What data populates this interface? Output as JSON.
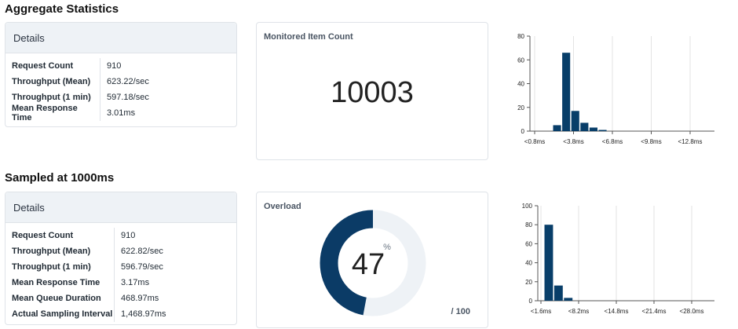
{
  "sections": [
    {
      "title": "Aggregate Statistics",
      "details": {
        "header": "Details",
        "rows": [
          {
            "label": "Request Count",
            "value": "910"
          },
          {
            "label": "Throughput (Mean)",
            "value": "623.22/sec"
          },
          {
            "label": "Throughput (1 min)",
            "value": "597.18/sec"
          },
          {
            "label": "Mean Response Time",
            "value": "3.01ms"
          }
        ]
      },
      "metric": {
        "title": "Monitored Item Count",
        "value": "10003"
      }
    },
    {
      "title": "Sampled at 1000ms",
      "details": {
        "header": "Details",
        "rows": [
          {
            "label": "Request Count",
            "value": "910"
          },
          {
            "label": "Throughput (Mean)",
            "value": "622.82/sec"
          },
          {
            "label": "Throughput (1 min)",
            "value": "596.79/sec"
          },
          {
            "label": "Mean Response Time",
            "value": "3.17ms"
          },
          {
            "label": "Mean Queue Duration",
            "value": "468.97ms"
          },
          {
            "label": "Actual Sampling Interval",
            "value": "1,468.97ms"
          }
        ]
      },
      "gauge": {
        "title": "Overload",
        "value": "47",
        "unit": "%",
        "max_label": "/ 100",
        "fraction": 0.47
      }
    }
  ],
  "colors": {
    "bar": "#083e69",
    "gauge_fill": "#0b3b66",
    "gauge_track": "#eef2f6"
  },
  "chart_data": [
    {
      "type": "bar",
      "ylim": [
        0,
        80
      ],
      "yticks": [
        "0",
        "20",
        "40",
        "60",
        "80"
      ],
      "xtick_labels": [
        "<0.8ms",
        "<3.8ms",
        "<6.8ms",
        "<9.8ms",
        "<12.8ms"
      ],
      "values": [
        5,
        66,
        17,
        7,
        3,
        1,
        0,
        0,
        0,
        0,
        0,
        0,
        0,
        0
      ]
    },
    {
      "type": "bar",
      "ylim": [
        0,
        100
      ],
      "yticks": [
        "0",
        "20",
        "40",
        "60",
        "80",
        "100"
      ],
      "xtick_labels": [
        "<1.6ms",
        "<8.2ms",
        "<14.8ms",
        "<21.4ms",
        "<28.0ms"
      ],
      "values": [
        80,
        16,
        3,
        0,
        0,
        0,
        0,
        0,
        0,
        0,
        0,
        0,
        0
      ]
    }
  ]
}
